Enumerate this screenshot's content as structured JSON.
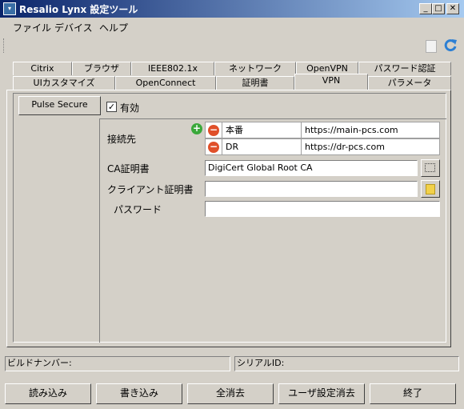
{
  "window": {
    "title": "Resalio Lynx 設定ツール",
    "icon_name": "app-icon",
    "controls": [
      "minimize-icon",
      "maximize-icon",
      "close-icon"
    ],
    "title_gradient": [
      "#0a246a",
      "#a6caf0"
    ]
  },
  "menubar": {
    "items": [
      "ファイル",
      "デバイス",
      "ヘルプ"
    ]
  },
  "toolbar": {
    "icons": [
      "page-icon",
      "refresh-icon"
    ]
  },
  "tabs": {
    "row1": [
      "Citrix",
      "ブラウザ",
      "IEEE802.1x",
      "ネットワーク",
      "OpenVPN",
      "パスワード認証"
    ],
    "row2": [
      "UIカスタマイズ",
      "OpenConnect",
      "証明書",
      "VPN",
      "パラメータ"
    ],
    "active": "VPN"
  },
  "vpn": {
    "profile_tab": "Pulse Secure",
    "enabled_label": "有効",
    "enabled": true,
    "destinations_label": "接続先",
    "destinations": [
      {
        "name": "本番",
        "url": "https://main-pcs.com"
      },
      {
        "name": "DR",
        "url": "https://dr-pcs.com"
      }
    ],
    "ca_cert_label": "CA証明書",
    "ca_cert_value": "DigiCert Global Root CA",
    "client_cert_label": "クライアント証明書",
    "client_cert_value": "",
    "password_label": "パスワード",
    "password_value": ""
  },
  "status": {
    "build_label": "ビルドナンバー:",
    "serial_label": "シリアルID:"
  },
  "buttons": {
    "load": "読み込み",
    "write": "書き込み",
    "clear_all": "全消去",
    "clear_user": "ユーザ設定消去",
    "exit": "終了"
  },
  "colors": {
    "face": "#d4d0c8",
    "add_green": "#3aa83a",
    "remove_red": "#e0502a"
  }
}
